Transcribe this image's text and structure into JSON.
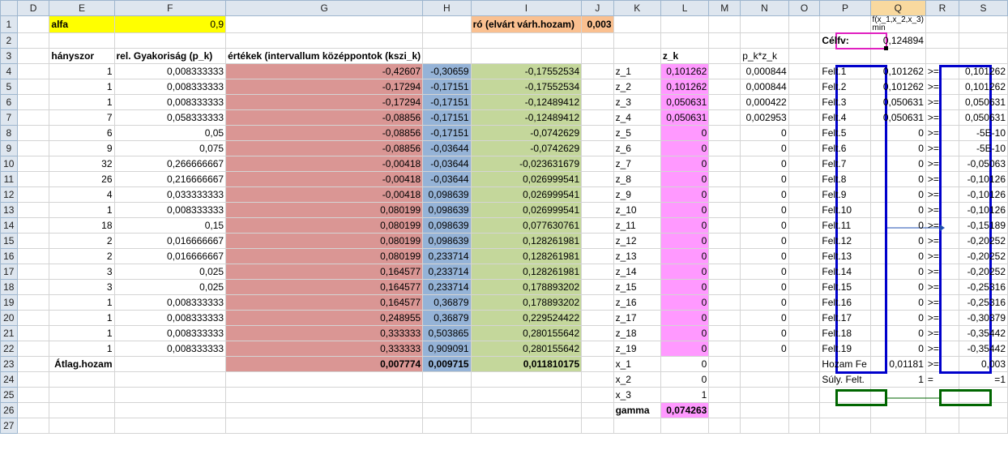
{
  "columns": [
    "D",
    "E",
    "F",
    "G",
    "H",
    "I",
    "J",
    "K",
    "L",
    "M",
    "N",
    "O",
    "P",
    "Q",
    "R",
    "S"
  ],
  "row_numbers": [
    1,
    2,
    3,
    4,
    5,
    6,
    7,
    8,
    9,
    10,
    11,
    12,
    13,
    14,
    15,
    16,
    17,
    18,
    19,
    20,
    21,
    22,
    23,
    24,
    25,
    26,
    27
  ],
  "cells": {
    "E1": "alfa",
    "F1": "0,9",
    "I1": "ró (elvárt várh.hozam)",
    "J1": "0,003",
    "Q1": "f(x_1,x_2,x_3)",
    "Q1_sub": "min",
    "P2": "Célfv:",
    "Q2": "0,124894",
    "E3": "hányszor",
    "F3": "rel. Gyakoriság (p_k)",
    "G3": "értékek (intervallum középpontok (kszi_k)",
    "L3": "z_k",
    "N3": "p_k*z_k",
    "E23": "Átlag.hozam",
    "G23": "0,007774",
    "H23": "0,009715",
    "I23": "0,011810175",
    "K23": "x_1",
    "L23": "0",
    "P23": "Hozam Fe",
    "Q23": "0,01181",
    "R23": ">=",
    "S23": "0,003",
    "K24": "x_2",
    "L24": "0",
    "P24": "Súly. Felt.",
    "Q24": "1",
    "R24": "=",
    "S24": "=",
    "S24b": "1",
    "K25": "x_3",
    "L25": "1",
    "K26": "gamma",
    "L26": "0,074263"
  },
  "rows": [
    {
      "E": "1",
      "F": "0,008333333",
      "G": "-0,42607",
      "H": "-0,30659",
      "I": "-0,17552534",
      "K": "z_1",
      "L": "0,101262",
      "N": "0,000844",
      "P": "Felt.1",
      "Q": "0,101262",
      "R": ">=",
      "S": "0,101262"
    },
    {
      "E": "1",
      "F": "0,008333333",
      "G": "-0,17294",
      "H": "-0,17151",
      "I": "-0,17552534",
      "K": "z_2",
      "L": "0,101262",
      "N": "0,000844",
      "P": "Felt.2",
      "Q": "0,101262",
      "R": ">=",
      "S": "0,101262"
    },
    {
      "E": "1",
      "F": "0,008333333",
      "G": "-0,17294",
      "H": "-0,17151",
      "I": "-0,12489412",
      "K": "z_3",
      "L": "0,050631",
      "N": "0,000422",
      "P": "Felt.3",
      "Q": "0,050631",
      "R": ">=",
      "S": "0,050631"
    },
    {
      "E": "7",
      "F": "0,058333333",
      "G": "-0,08856",
      "H": "-0,17151",
      "I": "-0,12489412",
      "K": "z_4",
      "L": "0,050631",
      "N": "0,002953",
      "P": "Felt.4",
      "Q": "0,050631",
      "R": ">=",
      "S": "0,050631"
    },
    {
      "E": "6",
      "F": "0,05",
      "G": "-0,08856",
      "H": "-0,17151",
      "I": "-0,0742629",
      "K": "z_5",
      "L": "0",
      "N": "0",
      "P": "Felt.5",
      "Q": "0",
      "R": ">=",
      "S": "-5E-10"
    },
    {
      "E": "9",
      "F": "0,075",
      "G": "-0,08856",
      "H": "-0,03644",
      "I": "-0,0742629",
      "K": "z_6",
      "L": "0",
      "N": "0",
      "P": "Felt.6",
      "Q": "0",
      "R": ">=",
      "S": "-5E-10"
    },
    {
      "E": "32",
      "F": "0,266666667",
      "G": "-0,00418",
      "H": "-0,03644",
      "I": "-0,023631679",
      "K": "z_7",
      "L": "0",
      "N": "0",
      "P": "Felt.7",
      "Q": "0",
      "R": ">=",
      "S": "-0,05063"
    },
    {
      "E": "26",
      "F": "0,216666667",
      "G": "-0,00418",
      "H": "-0,03644",
      "I": "0,026999541",
      "K": "z_8",
      "L": "0",
      "N": "0",
      "P": "Felt.8",
      "Q": "0",
      "R": ">=",
      "S": "-0,10126"
    },
    {
      "E": "4",
      "F": "0,033333333",
      "G": "-0,00418",
      "H": "0,098639",
      "I": "0,026999541",
      "K": "z_9",
      "L": "0",
      "N": "0",
      "P": "Felt.9",
      "Q": "0",
      "R": ">=",
      "S": "-0,10126"
    },
    {
      "E": "1",
      "F": "0,008333333",
      "G": "0,080199",
      "H": "0,098639",
      "I": "0,026999541",
      "K": "z_10",
      "L": "0",
      "N": "0",
      "P": "Felt.10",
      "Q": "0",
      "R": ">=",
      "S": "-0,10126"
    },
    {
      "E": "18",
      "F": "0,15",
      "G": "0,080199",
      "H": "0,098639",
      "I": "0,077630761",
      "K": "z_11",
      "L": "0",
      "N": "0",
      "P": "Felt.11",
      "Q": "0",
      "R": ">=",
      "S": "-0,15189"
    },
    {
      "E": "2",
      "F": "0,016666667",
      "G": "0,080199",
      "H": "0,098639",
      "I": "0,128261981",
      "K": "z_12",
      "L": "0",
      "N": "0",
      "P": "Felt.12",
      "Q": "0",
      "R": ">=",
      "S": "-0,20252"
    },
    {
      "E": "2",
      "F": "0,016666667",
      "G": "0,080199",
      "H": "0,233714",
      "I": "0,128261981",
      "K": "z_13",
      "L": "0",
      "N": "0",
      "P": "Felt.13",
      "Q": "0",
      "R": ">=",
      "S": "-0,20252"
    },
    {
      "E": "3",
      "F": "0,025",
      "G": "0,164577",
      "H": "0,233714",
      "I": "0,128261981",
      "K": "z_14",
      "L": "0",
      "N": "0",
      "P": "Felt.14",
      "Q": "0",
      "R": ">=",
      "S": "-0,20252"
    },
    {
      "E": "3",
      "F": "0,025",
      "G": "0,164577",
      "H": "0,233714",
      "I": "0,178893202",
      "K": "z_15",
      "L": "0",
      "N": "0",
      "P": "Felt.15",
      "Q": "0",
      "R": ">=",
      "S": "-0,25316"
    },
    {
      "E": "1",
      "F": "0,008333333",
      "G": "0,164577",
      "H": "0,36879",
      "I": "0,178893202",
      "K": "z_16",
      "L": "0",
      "N": "0",
      "P": "Felt.16",
      "Q": "0",
      "R": ">=",
      "S": "-0,25316"
    },
    {
      "E": "1",
      "F": "0,008333333",
      "G": "0,248955",
      "H": "0,36879",
      "I": "0,229524422",
      "K": "z_17",
      "L": "0",
      "N": "0",
      "P": "Felt.17",
      "Q": "0",
      "R": ">=",
      "S": "-0,30379"
    },
    {
      "E": "1",
      "F": "0,008333333",
      "G": "0,333333",
      "H": "0,503865",
      "I": "0,280155642",
      "K": "z_18",
      "L": "0",
      "N": "0",
      "P": "Felt.18",
      "Q": "0",
      "R": ">=",
      "S": "-0,35442"
    },
    {
      "E": "1",
      "F": "0,008333333",
      "G": "0,333333",
      "H": "0,909091",
      "I": "0,280155642",
      "K": "z_19",
      "L": "0",
      "N": "0",
      "P": "Felt.19",
      "Q": "0",
      "R": ">=",
      "S": "-0,35442"
    }
  ],
  "colors": {
    "yellow": "#ffff00",
    "orange": "#fac090",
    "red": "#da9694",
    "blue": "#95b3d7",
    "green": "#c4d79b",
    "pink": "#ff99ff",
    "outline_blue": "#0000cc",
    "outline_green": "#006600",
    "outline_pink": "#e020c0"
  }
}
